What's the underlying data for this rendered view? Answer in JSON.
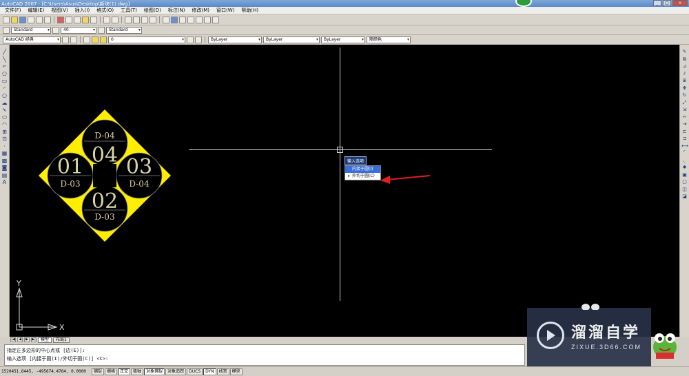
{
  "window": {
    "title": "AutoCAD 2007 - [C:\\Users\\Asus\\Desktop\\新块(1).dwg]",
    "min": "_",
    "max": "□",
    "close": "×"
  },
  "menu": [
    "文件(F)",
    "编辑(E)",
    "视图(V)",
    "插入(I)",
    "格式(O)",
    "工具(T)",
    "绘图(D)",
    "标注(N)",
    "修改(M)",
    "窗口(W)",
    "帮助(H)"
  ],
  "toolbar_styles": {
    "text_style": "Standard",
    "dim_scale": "40",
    "dim_style": "Standard"
  },
  "toolbar_layers": {
    "workspace": "AutoCAD 经典",
    "layer": "0",
    "color": "ByLayer",
    "linetype": "ByLayer",
    "lineweight": "ByLayer",
    "plotstyle": "随颜色"
  },
  "drawing": {
    "circles": [
      {
        "number": "04",
        "label": "D-04"
      },
      {
        "number": "01",
        "label": "D-03"
      },
      {
        "number": "03",
        "label": "D-04"
      },
      {
        "number": "02",
        "label": "D-03"
      }
    ],
    "colors": {
      "diamond": "#ffee00",
      "text": "#d8d4a8",
      "lines": "#000000"
    }
  },
  "dynamic_input": {
    "prompt": "输入选项",
    "options": [
      {
        "label": "内接于圆(I)",
        "highlighted": true
      },
      {
        "label": "外切于圆(C)",
        "highlighted": false,
        "selected": true
      }
    ]
  },
  "ucs": {
    "x_label": "X",
    "y_label": "Y"
  },
  "layout_tabs": [
    "模型",
    "布局1"
  ],
  "layout_nav": [
    "|◀",
    "◀",
    "▶",
    "▶|"
  ],
  "command_lines": [
    "指定正多边形的中心点或 [边(E)]:",
    "输入选项 [内接于圆(I)/外切于圆(C)] <C>:"
  ],
  "status": {
    "coords": "1520451.6445, -495674.4764, 0.0000",
    "toggles": [
      {
        "label": "捕捉",
        "on": false
      },
      {
        "label": "栅格",
        "on": false
      },
      {
        "label": "正交",
        "on": true
      },
      {
        "label": "极轴",
        "on": false
      },
      {
        "label": "对象捕捉",
        "on": true
      },
      {
        "label": "对象追踪",
        "on": false
      },
      {
        "label": "DUCS",
        "on": false
      },
      {
        "label": "DYN",
        "on": true
      },
      {
        "label": "线宽",
        "on": false
      },
      {
        "label": "模型",
        "on": false
      }
    ]
  },
  "watermark": {
    "cn": "溜溜自学",
    "en": "ZIXUE.3D66.COM"
  }
}
